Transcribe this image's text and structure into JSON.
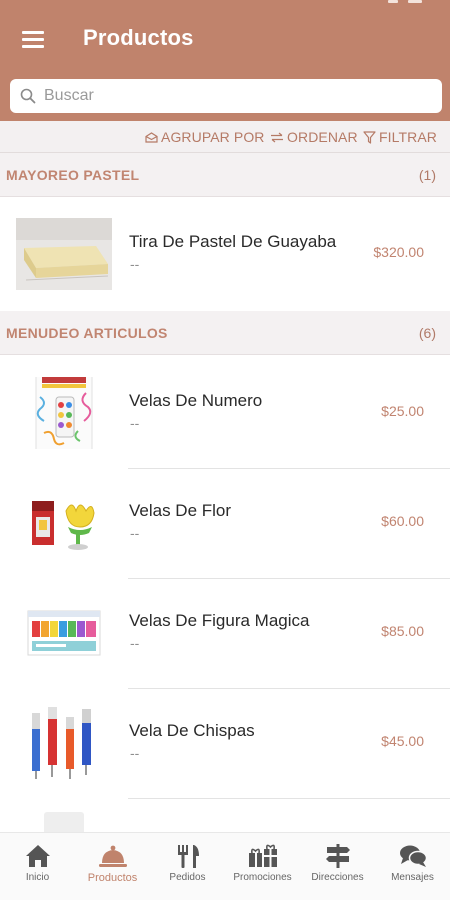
{
  "header": {
    "title": "Productos"
  },
  "search": {
    "placeholder": "Buscar"
  },
  "toolbar": {
    "group_label": "AGRUPAR POR",
    "sort_label": "ORDENAR",
    "filter_label": "FILTRAR"
  },
  "sections": [
    {
      "title": "MAYOREO PASTEL",
      "count": "(1)",
      "items": [
        {
          "name": "Tira De Pastel De Guayaba",
          "subtitle": "--",
          "price": "$320.00",
          "image": "guava-cake-strip"
        }
      ]
    },
    {
      "title": "MENUDEO ARTICULOS",
      "count": "(6)",
      "items": [
        {
          "name": "Velas De Numero",
          "subtitle": "--",
          "price": "$25.00",
          "image": "number-candle-package"
        },
        {
          "name": "Velas De Flor",
          "subtitle": "--",
          "price": "$60.00",
          "image": "flower-candle"
        },
        {
          "name": "Velas De Figura Magica",
          "subtitle": "--",
          "price": "$85.00",
          "image": "birthday-letter-candles"
        },
        {
          "name": "Vela De Chispas",
          "subtitle": "--",
          "price": "$45.00",
          "image": "sparkler-candles"
        }
      ]
    }
  ],
  "bottom_nav": [
    {
      "label": "Inicio",
      "icon": "home-icon",
      "active": false
    },
    {
      "label": "Productos",
      "icon": "cloche-icon",
      "active": true
    },
    {
      "label": "Pedidos",
      "icon": "utensils-icon",
      "active": false
    },
    {
      "label": "Promociones",
      "icon": "gifts-icon",
      "active": false
    },
    {
      "label": "Direcciones",
      "icon": "signpost-icon",
      "active": false
    },
    {
      "label": "Mensajes",
      "icon": "chat-icon",
      "active": false
    }
  ],
  "colors": {
    "brand": "#c0836c",
    "accent_text": "#c18571",
    "section_bg": "#f4f1f2",
    "nav_icon": "#555555"
  }
}
